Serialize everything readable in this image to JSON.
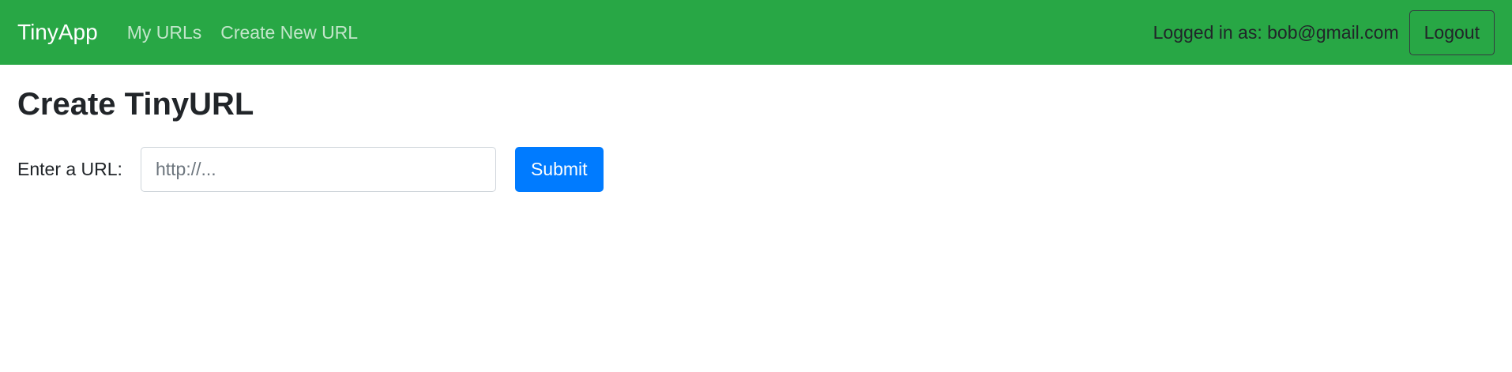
{
  "navbar": {
    "brand": "TinyApp",
    "links": [
      {
        "label": "My URLs"
      },
      {
        "label": "Create New URL"
      }
    ],
    "logged_in_text": "Logged in as: bob@gmail.com",
    "logout_label": "Logout"
  },
  "main": {
    "title": "Create TinyURL",
    "form": {
      "label": "Enter a URL:",
      "input_value": "",
      "input_placeholder": "http://...",
      "submit_label": "Submit"
    }
  },
  "colors": {
    "navbar_bg": "#28a745",
    "primary": "#007bff"
  }
}
